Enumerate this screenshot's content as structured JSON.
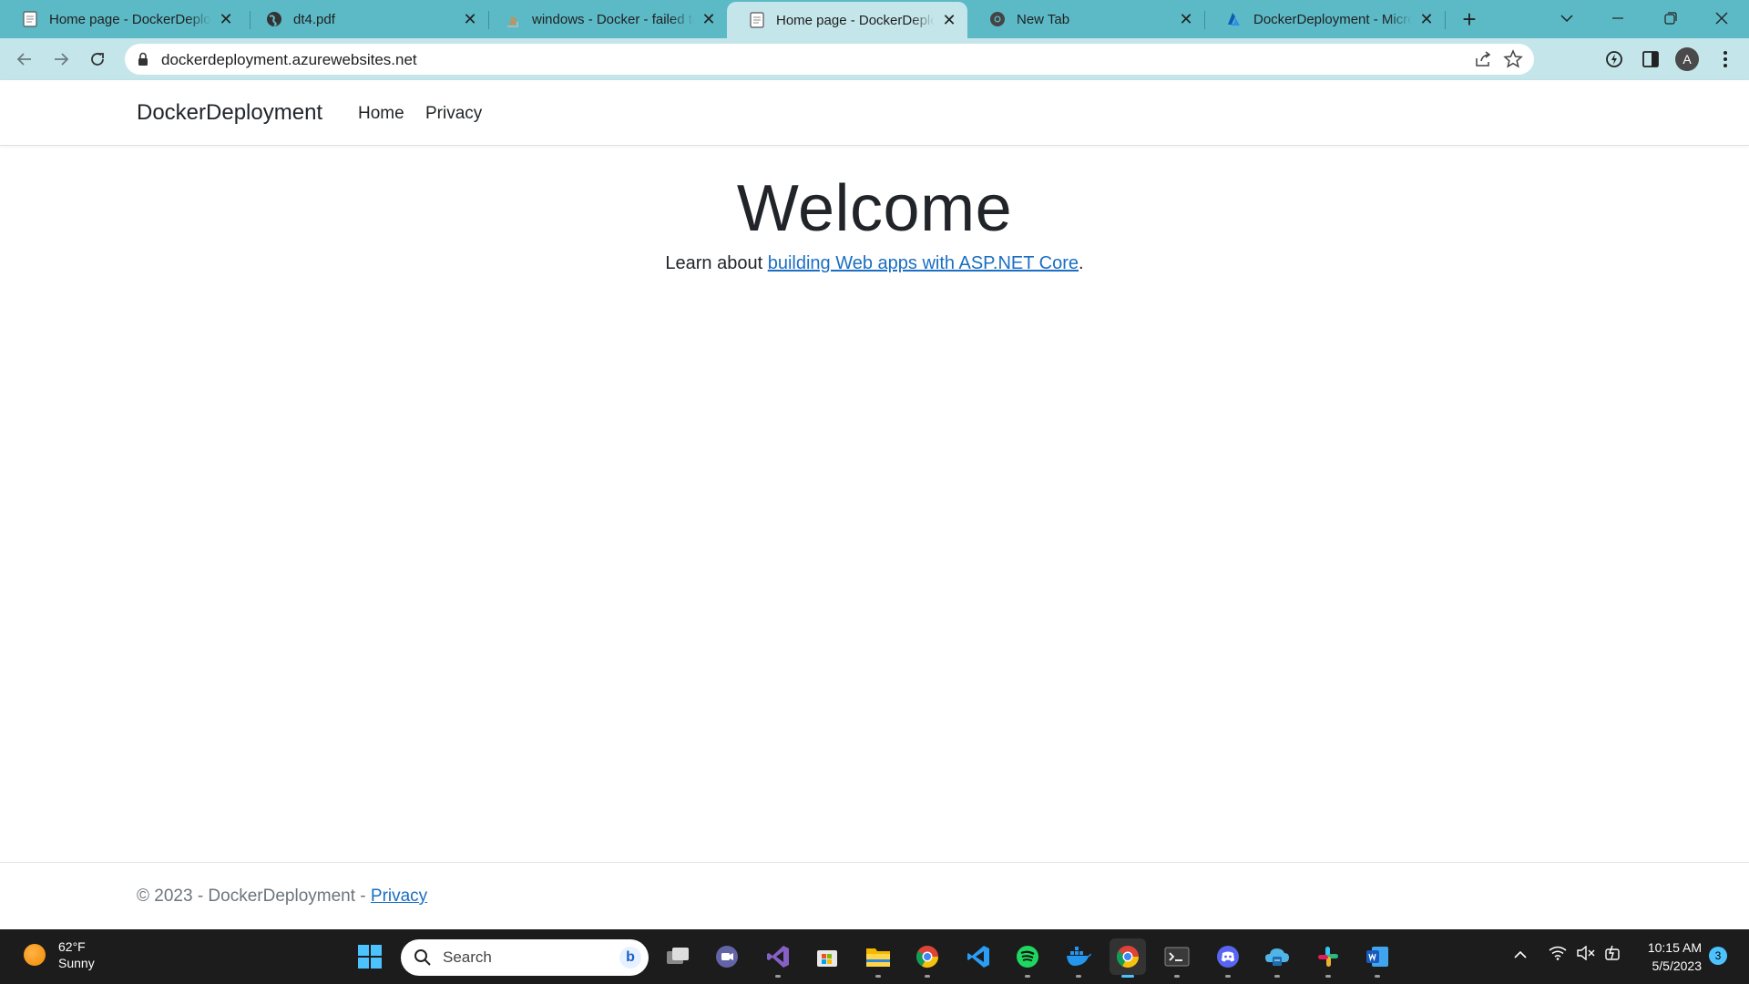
{
  "browser": {
    "tabs": [
      {
        "title": "Home page - DockerDeployment",
        "active": false,
        "favicon": "page-icon"
      },
      {
        "title": "dt4.pdf",
        "active": false,
        "favicon": "globe-icon"
      },
      {
        "title": "windows - Docker - failed to",
        "active": false,
        "favicon": "stackoverflow-icon"
      },
      {
        "title": "Home page - DockerDeployment",
        "active": true,
        "favicon": "page-icon"
      },
      {
        "title": "New Tab",
        "active": false,
        "favicon": "chrome-icon"
      },
      {
        "title": "DockerDeployment - Microsoft",
        "active": false,
        "favicon": "azure-icon"
      }
    ],
    "url": "dockerdeployment.azurewebsites.net",
    "profile_initial": "A"
  },
  "site": {
    "brand": "DockerDeployment",
    "nav": {
      "home": "Home",
      "privacy": "Privacy"
    },
    "heading": "Welcome",
    "learn_prefix": "Learn about ",
    "learn_link": "building Web apps with ASP.NET Core",
    "learn_suffix": ".",
    "footer_text": "© 2023 - DockerDeployment - ",
    "footer_link": "Privacy"
  },
  "taskbar": {
    "weather_temp": "62°F",
    "weather_cond": "Sunny",
    "search_placeholder": "Search",
    "apps": [
      "task-view-icon",
      "teams-icon",
      "visual-studio-icon",
      "store-icon",
      "file-explorer-icon",
      "chrome-icon",
      "vscode-icon",
      "spotify-icon",
      "docker-icon",
      "chrome-profile-icon",
      "terminal-icon",
      "discord-icon",
      "azure-data-studio-icon",
      "slack-icon",
      "word-icon"
    ],
    "time": "10:15 AM",
    "date": "5/5/2023",
    "notifications": "3"
  },
  "colors": {
    "tab_strip": "#5cbac7",
    "toolbar": "#c4e6ea",
    "link": "#1b6ec2",
    "taskbar": "#1c1c1c"
  }
}
